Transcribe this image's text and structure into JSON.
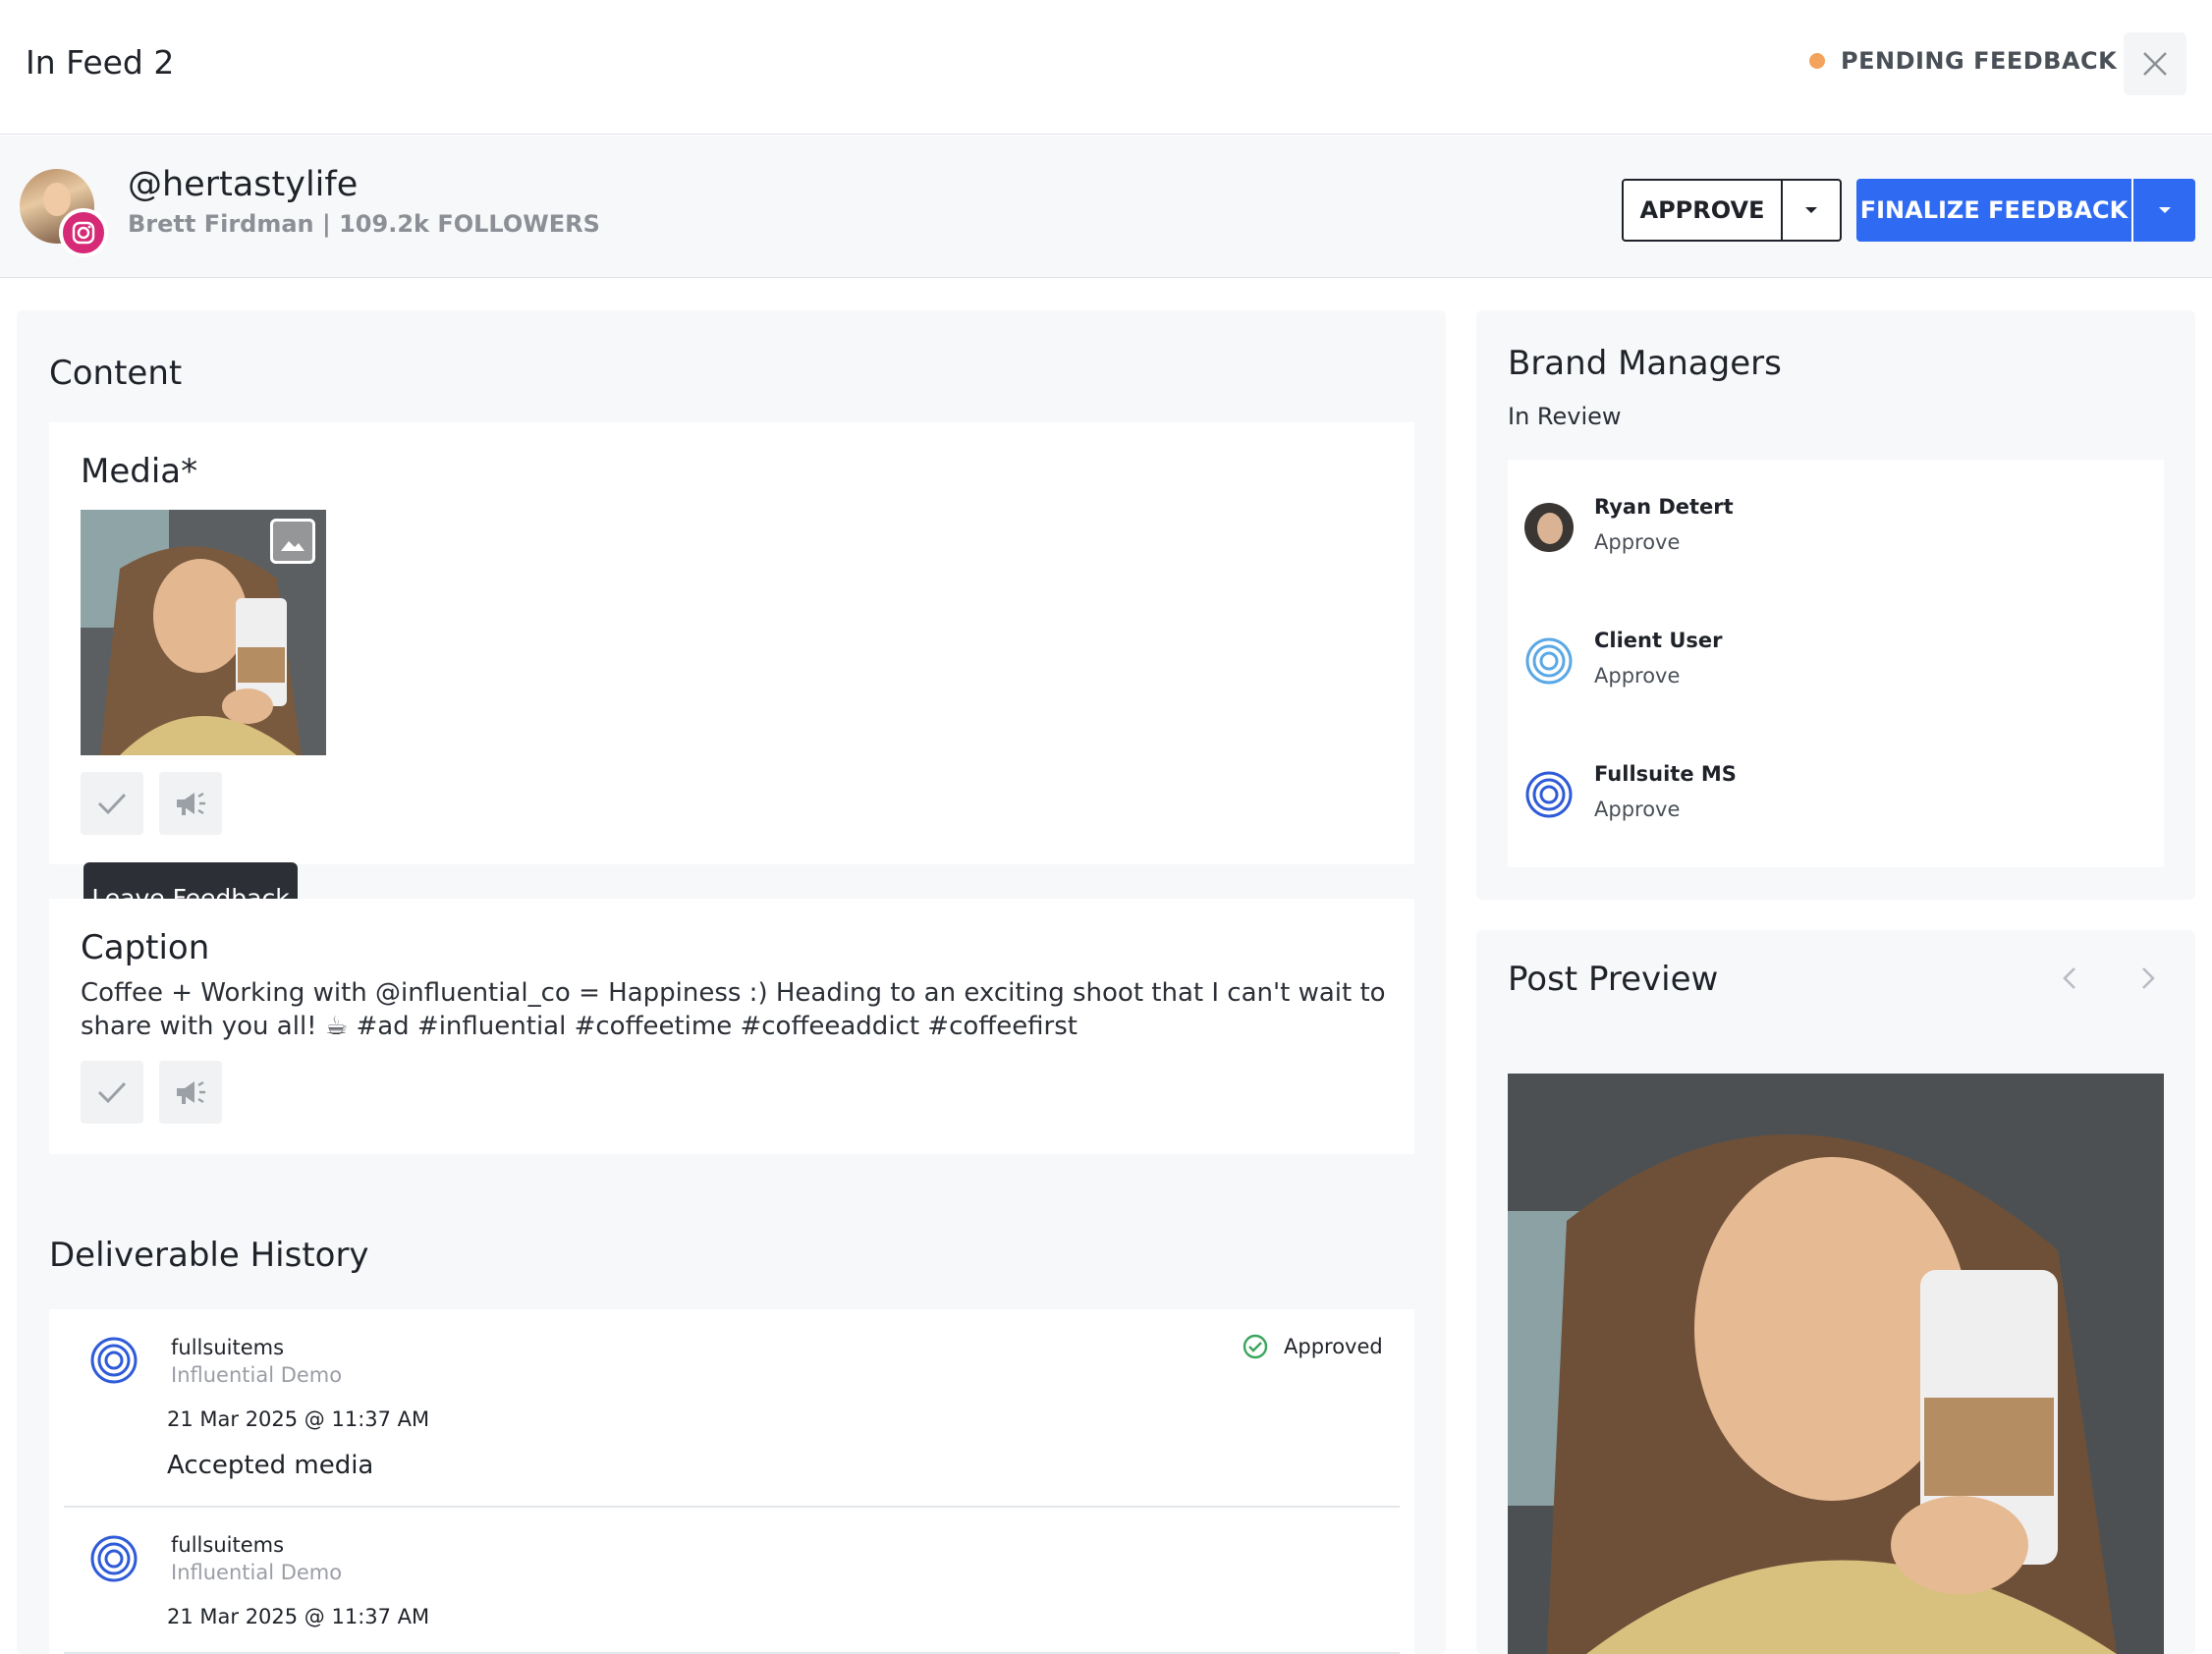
{
  "header": {
    "title": "In Feed 2",
    "status_label": "PENDING FEEDBACK",
    "status_color": "#f3a35b"
  },
  "influencer": {
    "handle": "@hertastylife",
    "subtitle": "Brett Firdman | 109.2k FOLLOWERS",
    "platform_icon": "instagram-icon"
  },
  "actions": {
    "approve_label": "APPROVE",
    "finalize_label": "FINALIZE FEEDBACK",
    "accent_color": "#2f6bf2"
  },
  "content": {
    "section_title": "Content",
    "media_title": "Media*",
    "tooltip": "Leave Feedback",
    "caption_title": "Caption",
    "caption_text": "Coffee + Working with @influential_co = Happiness :) Heading to an exciting shoot that I can't wait to share with you all! ☕ #ad #influential #coffeetime #coffeeaddict #coffeefirst"
  },
  "history": {
    "title": "Deliverable History",
    "items": [
      {
        "user": "fullsuitems",
        "org": "Influential Demo",
        "date": "21 Mar 2025 @ 11:37 AM",
        "note": "Accepted media",
        "status": "Approved"
      },
      {
        "user": "fullsuitems",
        "org": "Influential Demo",
        "date": "21 Mar 2025 @ 11:37 AM"
      }
    ]
  },
  "managers": {
    "title": "Brand Managers",
    "subtitle": "In Review",
    "list": [
      {
        "name": "Ryan Detert",
        "status": "Approve"
      },
      {
        "name": "Client User",
        "status": "Approve"
      },
      {
        "name": "Fullsuite MS",
        "status": "Approve"
      }
    ]
  },
  "preview": {
    "title": "Post Preview"
  }
}
